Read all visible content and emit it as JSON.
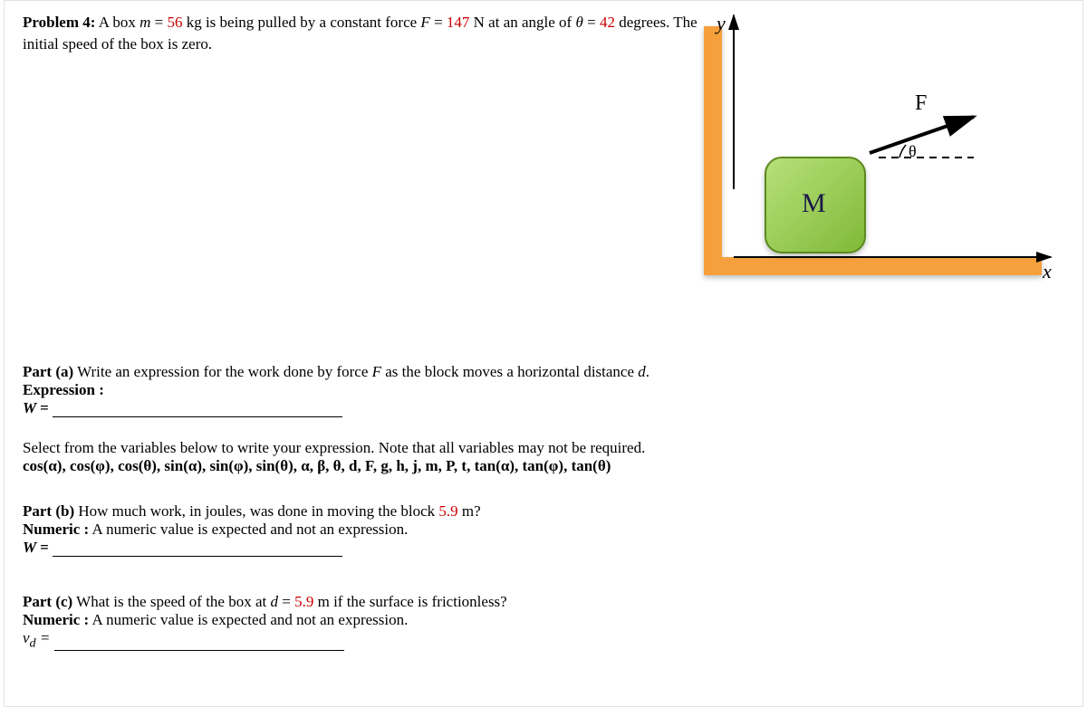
{
  "problem": {
    "label": "Problem 4:",
    "text_prefix": "A box ",
    "mass_var": "m",
    "eq": " = ",
    "mass_val": "56",
    "mass_unit": " kg is being pulled by a constant force ",
    "force_var": "F",
    "force_val": "147",
    "force_unit": " N at an angle of ",
    "angle_var": "θ",
    "angle_val": "42",
    "angle_after": " degrees. The initial speed of the box is zero."
  },
  "diagram": {
    "y": "y",
    "x": "x",
    "F": "F",
    "theta": "θ",
    "M": "M"
  },
  "part_a": {
    "label": "Part (a)",
    "text_prefix": " Write an expression for the work done by force ",
    "force_var": "F",
    "text_mid": " as the block moves a horizontal distance ",
    "dist_var": "d",
    "text_suffix": ".",
    "expr_label": "Expression   :",
    "W_label": "W =",
    "select_intro": "Select from the variables below to write your expression. Note that all variables may not be required.",
    "variables": "cos(α), cos(φ), cos(θ), sin(α), sin(φ), sin(θ), α, β, θ, d, F, g, h, j, m, P, t, tan(α), tan(φ), tan(θ)"
  },
  "part_b": {
    "label": "Part (b)",
    "text_prefix": " How much work, in joules, was done in moving the block ",
    "dist_val": "5.9",
    "dist_unit": " m?",
    "numeric_label": "Numeric   :",
    "numeric_text": " A numeric value is expected and not an expression.",
    "W_label": "W ="
  },
  "part_c": {
    "label": "Part (c)",
    "text_prefix": " What is the speed of the box at ",
    "d_var": "d",
    "eq": " = ",
    "dist_val": "5.9",
    "dist_unit": " m if the surface is frictionless?",
    "numeric_label": "Numeric   :",
    "numeric_text": " A numeric value is expected and not an expression.",
    "vd_label_v": "v",
    "vd_label_sub": "d",
    "vd_label_eq": " ="
  }
}
